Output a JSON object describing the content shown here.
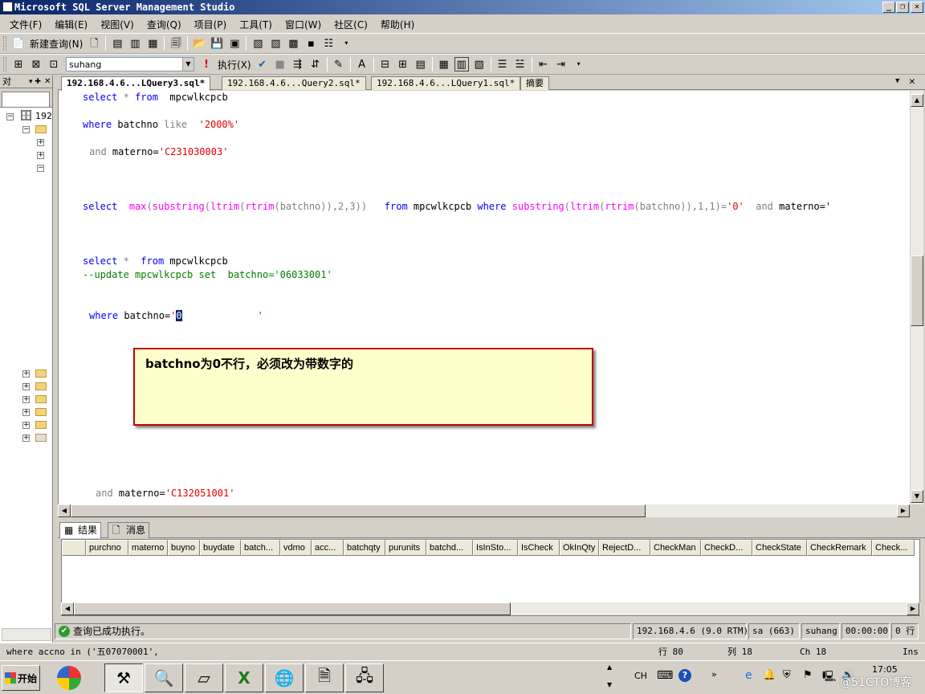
{
  "window": {
    "title": "Microsoft SQL Server Management Studio",
    "controls": [
      "_",
      "❐",
      "✕"
    ]
  },
  "menu": [
    "文件(F)",
    "编辑(E)",
    "视图(V)",
    "查询(Q)",
    "项目(P)",
    "工具(T)",
    "窗口(W)",
    "社区(C)",
    "帮助(H)"
  ],
  "toolbar1": {
    "new_query": "新建查询(N)"
  },
  "toolbar2": {
    "database": "suhang",
    "execute": "执行(X)"
  },
  "object_explorer": {
    "header": "对",
    "root": "192"
  },
  "tabs": [
    {
      "label": "192.168.4.6...LQuery3.sql*",
      "active": true
    },
    {
      "label": "192.168.4.6...Query2.sql*",
      "active": false
    },
    {
      "label": "192.168.4.6...LQuery1.sql*",
      "active": false
    },
    {
      "label": "摘要",
      "active": false
    }
  ],
  "editor": {
    "l1": {
      "kw1": "select",
      "op": "*",
      "kw2": "from",
      "rest": "mpcwlkcpcb"
    },
    "l2": {
      "kw": "where",
      "id": "batchno",
      "op": "like",
      "str": "'2000%'"
    },
    "l3": {
      "op": "and",
      "id": "materno=",
      "str": "'C231030003'"
    },
    "l4": {
      "kw": "select",
      "max": "max",
      "substring": "substring",
      "ltrim": "ltrim",
      "rtrim": "rtrim",
      "a1": "(batchno)),2,3))",
      "from": "from",
      "tbl": "mpcwlkcpcb",
      "where": "where",
      "substring2": "substring",
      "ltrim2": "ltrim",
      "rtrim2": "rtrim",
      "a2": "(batchno)),1,1)=",
      "str": "'0'",
      "and": "and",
      "tail": "materno='"
    },
    "l5": {
      "kw1": "select",
      "op": "*",
      "kw2": "from",
      "rest": "mpcwlkcpcb"
    },
    "l6": {
      "comment": "--update mpcwlkcpcb set  batchno=",
      "str": "'06033001'"
    },
    "l7": {
      "kw": "where",
      "id": "batchno=",
      "q1": "'",
      "sel": "0",
      "q2": "'"
    },
    "l8": {
      "op": "and",
      "id": "materno=",
      "str": "'C132051001'"
    }
  },
  "annotation": "batchno为0不行，必须改为带数字的",
  "results": {
    "tabs": [
      "结果",
      "消息"
    ],
    "columns": [
      "purchno",
      "materno",
      "buyno",
      "buydate",
      "batch...",
      "vdmo",
      "acc...",
      "batchqty",
      "purunits",
      "batchd...",
      "IsInSto...",
      "IsCheck",
      "OkInQty",
      "RejectD...",
      "CheckMan",
      "CheckD...",
      "CheckState",
      "CheckRemark",
      "Check..."
    ]
  },
  "status": {
    "message": "查询已成功执行。",
    "server": "192.168.4.6 (9.0 RTM)",
    "user": "sa (663)",
    "db": "suhang",
    "time": "00:00:00",
    "rows": "0 行"
  },
  "statusline": {
    "text": "where accno in ('五07070001',",
    "line": "行 80",
    "col": "列 18",
    "ch": "Ch 18",
    "mode": "Ins"
  },
  "taskbar": {
    "start": "开始",
    "lang": "CH",
    "clock": "17:05",
    "watermark": "@51CTO博客"
  }
}
